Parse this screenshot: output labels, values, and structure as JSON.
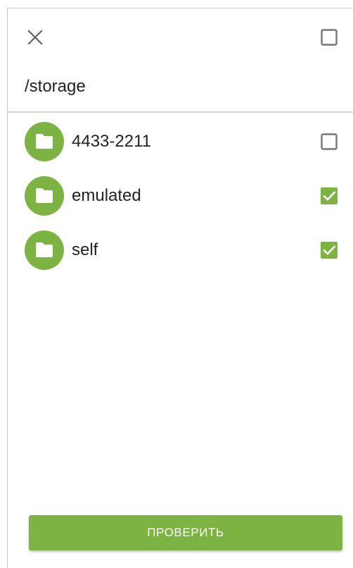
{
  "header": {
    "close_icon": "close-icon",
    "select_all_checked": false,
    "path": "/storage"
  },
  "folders": [
    {
      "name": "4433-2211",
      "icon": "folder-icon",
      "checked": false
    },
    {
      "name": "emulated",
      "icon": "folder-icon",
      "checked": true
    },
    {
      "name": "self",
      "icon": "folder-icon",
      "checked": true
    }
  ],
  "footer": {
    "button_label": "ПРОВЕРИТЬ"
  },
  "colors": {
    "accent": "#7cb342",
    "checkbox_border": "#757575",
    "divider": "#d6d6d6"
  }
}
